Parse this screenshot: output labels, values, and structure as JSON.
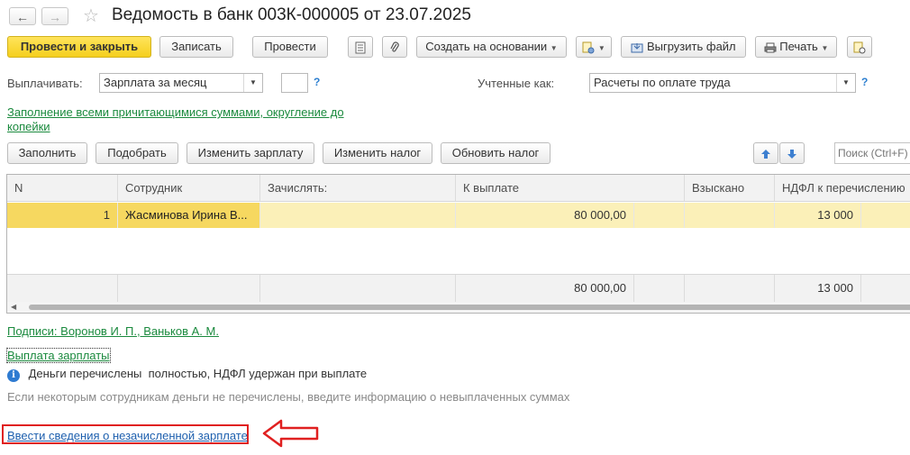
{
  "window": {
    "title": "Ведомость в банк 003К-000005 от 23.07.2025",
    "nav_back": "←",
    "nav_forward": "→",
    "favorite_icon": "☆"
  },
  "toolbar": {
    "post_close": "Провести и закрыть",
    "save": "Записать",
    "post": "Провести",
    "create_based": "Создать на основании",
    "export_file": "Выгрузить файл",
    "print": "Печать"
  },
  "form": {
    "pay_label": "Выплачивать:",
    "pay_value": "Зарплата за месяц",
    "accounted_label": "Учтенные как:",
    "accounted_value": "Расчеты по оплате труда",
    "help": "?",
    "fill_link_line1": "Заполнение всеми причитающимися суммами, округление до",
    "fill_link_line2": "копейки"
  },
  "table_toolbar": {
    "fill": "Заполнить",
    "pick": "Подобрать",
    "change_salary": "Изменить зарплату",
    "change_tax": "Изменить налог",
    "update_tax": "Обновить налог",
    "search_placeholder": "Поиск (Ctrl+F)"
  },
  "table": {
    "columns": [
      "N",
      "Сотрудник",
      "Зачислять:",
      "К выплате",
      "Взыскано",
      "НДФЛ к перечислению"
    ],
    "rows": [
      {
        "n": "1",
        "employee": "Жасминова Ирина В...",
        "account": "",
        "to_pay": "80 000,00",
        "withheld": "",
        "ndfl": "13 000"
      }
    ],
    "totals": {
      "to_pay": "80 000,00",
      "ndfl": "13 000"
    }
  },
  "footer": {
    "signatures_link": "Подписи: Воронов И. П., Ваньков А. М.",
    "salary_payment_link": "Выплата зарплаты",
    "info_text": "Деньги перечислены  полностью, НДФЛ удержан при выплате",
    "hint_text": "Если некоторым сотрудникам деньги не перечислены, введите информацию о невыплаченных суммах",
    "enter_link": "Ввести сведения о незачисленной зарплате"
  },
  "colors": {
    "primary_button": "#f5cf1c",
    "selected_row": "#fbf0b8",
    "link_green": "#1b8a3e",
    "link_blue": "#1d5fae",
    "highlight_red": "#e02020"
  }
}
